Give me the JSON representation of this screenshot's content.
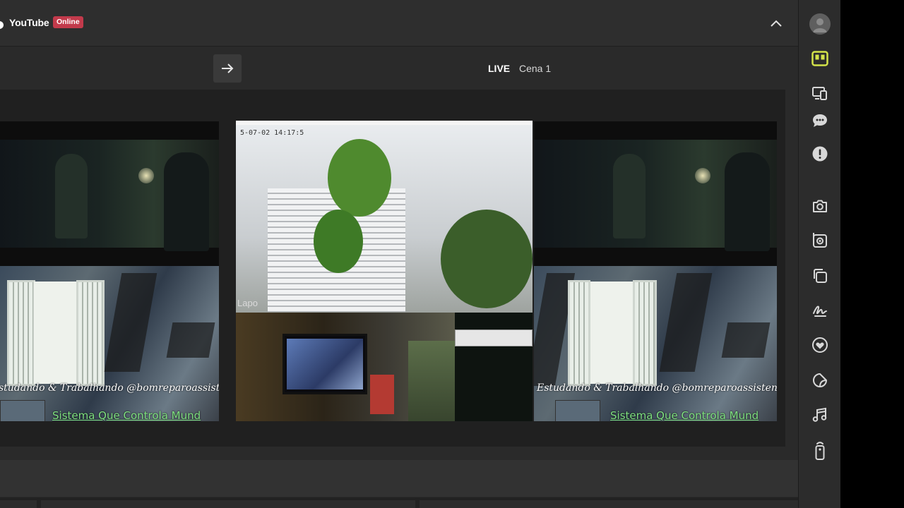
{
  "header": {
    "platform_name": "YouTube",
    "status_badge": "Online"
  },
  "toolbar": {
    "live_label": "LIVE",
    "scene_name": "Cena 1"
  },
  "preview": {
    "caption_text": "Estudando & Trabalhando @bomreparoassistenc",
    "caption_text_left": "studando & Trabalhando @bomreparoassistenc",
    "caption_green": "Sistema Que Controla Mund",
    "camera_timestamp": "5-07-02 14:17:5",
    "camera_brand": "Lapo"
  },
  "sidebar": {
    "items": [
      {
        "icon": "layout-icon",
        "active": true
      },
      {
        "icon": "devices-icon"
      },
      {
        "icon": "chat-icon"
      },
      {
        "icon": "alert-icon"
      },
      {
        "icon": "camera-icon"
      },
      {
        "icon": "camera-flip-icon"
      },
      {
        "icon": "copy-icon"
      },
      {
        "icon": "signature-icon"
      },
      {
        "icon": "heart-icon"
      },
      {
        "icon": "sticker-icon"
      },
      {
        "icon": "music-icon"
      },
      {
        "icon": "remote-icon"
      }
    ]
  },
  "colors": {
    "accent": "#d4e34a",
    "badge": "#c23a4b",
    "panel": "#2a2a2a",
    "preview_bg": "#202020"
  }
}
